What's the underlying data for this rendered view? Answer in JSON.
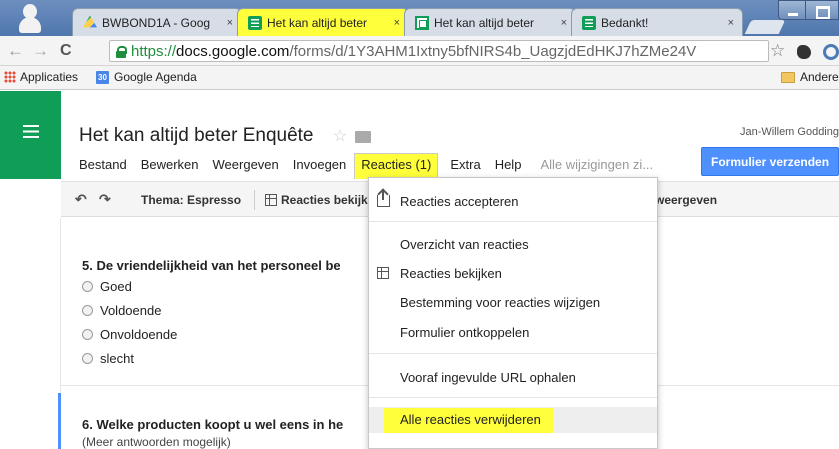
{
  "browser": {
    "tabs": [
      {
        "label": "BWBOND1A - Goog",
        "favicon": "drive-icon"
      },
      {
        "label": "Het kan altijd beter",
        "favicon": "forms-icon"
      },
      {
        "label": "Het kan altijd beter",
        "favicon": "sheets-icon"
      },
      {
        "label": "Bedankt!",
        "favicon": "forms-icon"
      }
    ],
    "tab_close": "×",
    "url": {
      "scheme": "https://",
      "host": "docs.google.com",
      "path": "/forms/d/1Y3AHM1Ixtny5bfNIRS4b_UagzjdEdHKJ7hZMe24V"
    },
    "bookmarks": [
      {
        "label": "Applicaties",
        "icon": "apps-icon"
      },
      {
        "label": "Google Agenda",
        "icon": "calendar-icon",
        "icon_text": "30"
      },
      {
        "label": "Andere bla",
        "icon": "folder-icon"
      }
    ]
  },
  "app": {
    "doc_title": "Het kan altijd beter Enquête",
    "user": "Jan-Willem Godding",
    "send_button": "Formulier verzenden",
    "autosave_status": "Alle wijzigingen zi...",
    "menus": [
      "Bestand",
      "Bewerken",
      "Weergeven",
      "Invoegen",
      "Reacties (1)",
      "Extra",
      "Help"
    ],
    "active_menu_index": 4,
    "accent_color": "#0f9d58",
    "highlight_color": "#ffff3b"
  },
  "toolbar": {
    "theme": "Thema: Espresso",
    "view_responses": "Reacties bekijk",
    "right_fragment": "weergeven"
  },
  "form": {
    "q5": {
      "title": "5. De vriendelijkheid van het personeel be",
      "options": [
        "Goed",
        "Voldoende",
        "Onvoldoende",
        "slecht"
      ]
    },
    "q6": {
      "title": "6. Welke producten koopt u wel eens in he",
      "help": "(Meer antwoorden mogelijk)"
    }
  },
  "dropdown": {
    "items": [
      {
        "label": "Reacties accepteren",
        "icon": "accept-responses-icon"
      },
      {
        "label": "Overzicht van reacties"
      },
      {
        "label": "Reacties bekijken",
        "icon": "spreadsheet-grid-icon"
      },
      {
        "label": "Bestemming voor reacties wijzigen"
      },
      {
        "label": "Formulier ontkoppelen"
      },
      {
        "label": "Vooraf ingevulde URL ophalen"
      },
      {
        "label": "Alle reacties verwijderen",
        "highlighted": true
      }
    ]
  }
}
